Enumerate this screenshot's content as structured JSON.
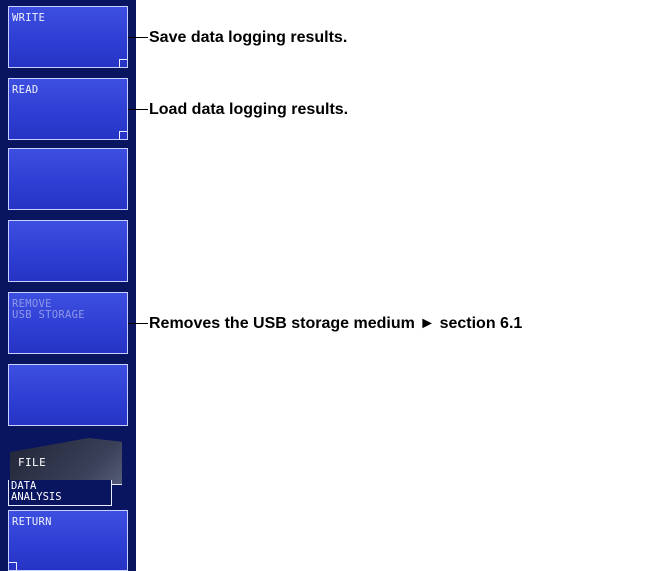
{
  "softkeys": {
    "write": "WRITE",
    "read": "READ",
    "remove_usb": "REMOVE\nUSB STORAGE",
    "return": "RETURN"
  },
  "menu_tabs": {
    "file": "FILE",
    "data_analysis": "DATA\nANALYSIS"
  },
  "callouts": {
    "write": "Save data logging results.",
    "read": "Load data logging results.",
    "remove_usb": "Removes the USB storage medium ► section 6.1"
  },
  "colors": {
    "panel_bg": "#0a1560",
    "softkey_blue": "#2f3fd4",
    "softkey_border": "#c8d0ff",
    "disabled_text": "#8e98e6"
  }
}
